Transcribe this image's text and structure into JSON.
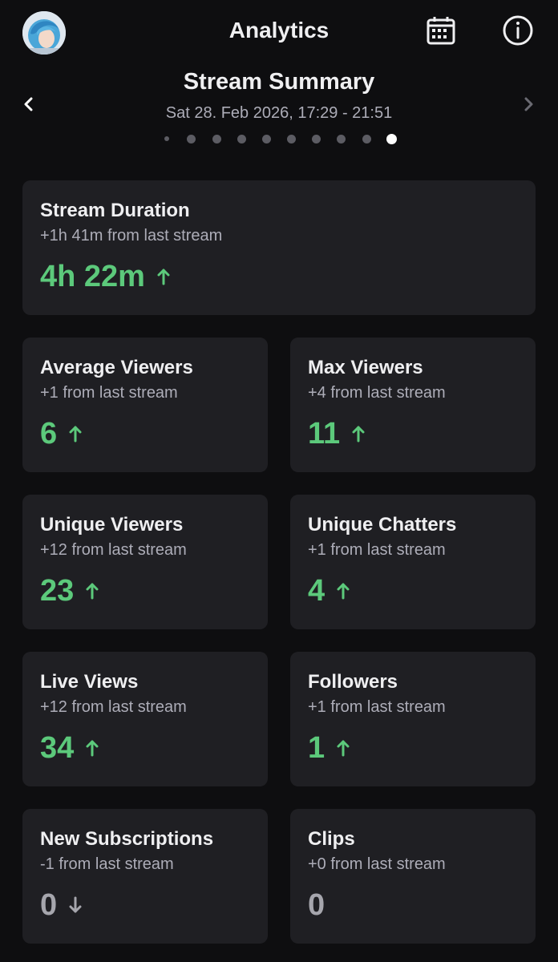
{
  "header": {
    "title": "Analytics"
  },
  "summary": {
    "title": "Stream Summary",
    "date": "Sat 28. Feb 2026, 17:29 - 21:51",
    "page_count": 10,
    "active_page": 10
  },
  "cards": {
    "duration": {
      "title": "Stream Duration",
      "sub": "+1h 41m from last stream",
      "value": "4h 22m",
      "trend": "up"
    },
    "avg_viewers": {
      "title": "Average Viewers",
      "sub": "+1 from last stream",
      "value": "6",
      "trend": "up"
    },
    "max_viewers": {
      "title": "Max Viewers",
      "sub": "+4 from last stream",
      "value": "11",
      "trend": "up"
    },
    "unique_viewers": {
      "title": "Unique Viewers",
      "sub": "+12 from last stream",
      "value": "23",
      "trend": "up"
    },
    "unique_chatters": {
      "title": "Unique Chatters",
      "sub": "+1 from last stream",
      "value": "4",
      "trend": "up"
    },
    "live_views": {
      "title": "Live Views",
      "sub": "+12 from last stream",
      "value": "34",
      "trend": "up"
    },
    "followers": {
      "title": "Followers",
      "sub": "+1 from last stream",
      "value": "1",
      "trend": "up"
    },
    "new_subs": {
      "title": "New Subscriptions",
      "sub": "-1 from last stream",
      "value": "0",
      "trend": "down"
    },
    "clips": {
      "title": "Clips",
      "sub": "+0 from last stream",
      "value": "0",
      "trend": "flat"
    }
  },
  "colors": {
    "background": "#0e0e10",
    "card": "#1f1f23",
    "up": "#5cc97b",
    "neutral": "#a6a6ad"
  },
  "icons": [
    "avatar",
    "calendar-icon",
    "info-icon",
    "chevron-left-icon",
    "chevron-right-icon",
    "arrow-up-icon",
    "arrow-down-icon"
  ]
}
